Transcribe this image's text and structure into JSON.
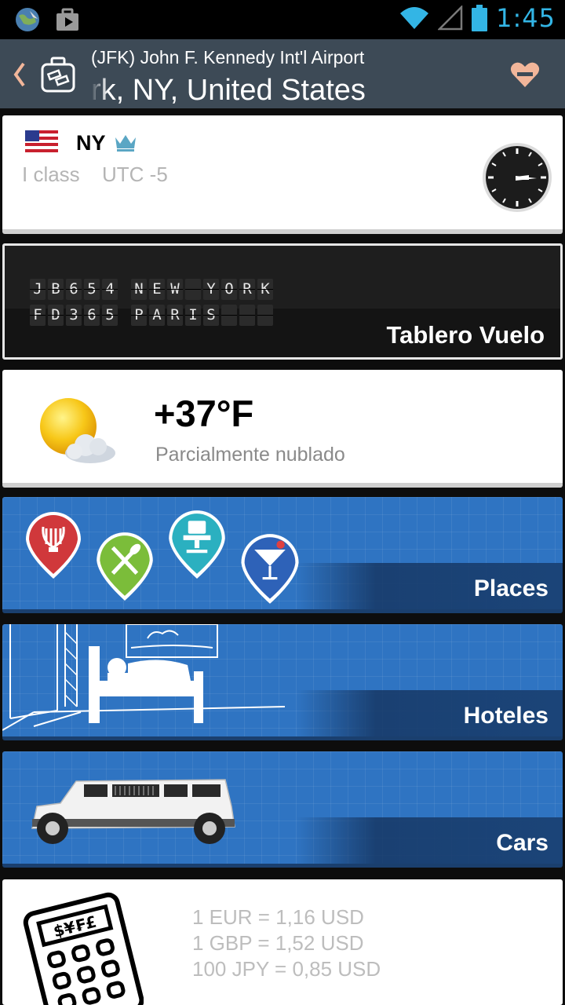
{
  "status_bar": {
    "time": "1:45",
    "icons": [
      "app-globe-icon",
      "media-play-icon",
      "wifi-icon",
      "signal-icon",
      "battery-icon"
    ],
    "time_color": "#33b5e5"
  },
  "action_bar": {
    "subtitle": "(JFK) John F. Kennedy Int'l Airport",
    "title": "rk, NY, United States",
    "icons": [
      "back-chevron-icon",
      "luggage-icon",
      "heart-minus-icon"
    ],
    "background": "#3d4a56"
  },
  "location": {
    "code": "NY",
    "class_label": "I class",
    "utc_label": "UTC -5",
    "icons": [
      "us-flag-icon",
      "crown-icon",
      "clock-icon"
    ]
  },
  "flight_board": {
    "rows": [
      {
        "flight": [
          "J",
          "B",
          "6",
          "5",
          "4"
        ],
        "dest": [
          "N",
          "E",
          "W",
          " ",
          "Y",
          "O",
          "R",
          "K"
        ]
      },
      {
        "flight": [
          "F",
          "D",
          "3",
          "6",
          "5"
        ],
        "dest": [
          "P",
          "A",
          "R",
          "I",
          "S",
          " ",
          " ",
          " "
        ]
      }
    ],
    "label": "Tablero Vuelo"
  },
  "weather": {
    "temperature": "+37°F",
    "description": "Parcialmente nublado",
    "icon": "partly-cloudy-icon"
  },
  "places": {
    "label": "Places",
    "icons": [
      "lyre-pin-icon",
      "restaurant-pin-icon",
      "office-chair-pin-icon",
      "cocktail-pin-icon"
    ]
  },
  "hotels": {
    "label": "Hoteles",
    "icon": "bed-room-icon"
  },
  "cars": {
    "label": "Cars",
    "icon": "limousine-icon"
  },
  "currency": {
    "rates": [
      "1 EUR = 1,16 USD",
      "1 GBP = 1,52 USD",
      "100 JPY = 0,85 USD"
    ],
    "calculator_symbols": "$¥₣£",
    "icon": "calculator-icon"
  },
  "colors": {
    "blue_card": "#2f74c2",
    "dark_band": "#1b4478",
    "heart": "#f2b69a"
  }
}
